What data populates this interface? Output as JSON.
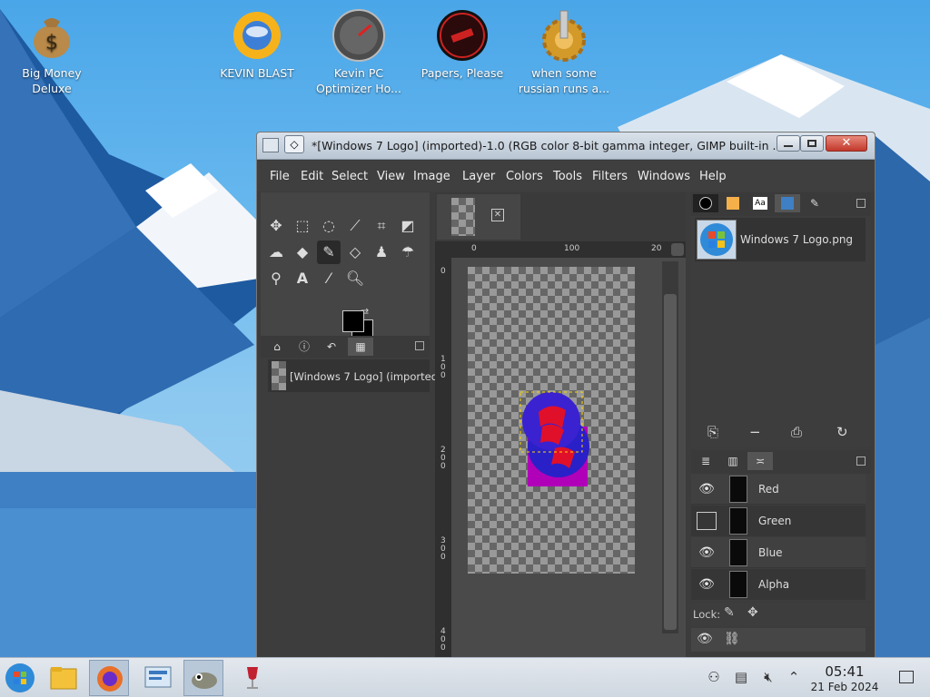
{
  "desktop": {
    "icons": [
      {
        "label": "Big Money Deluxe"
      },
      {
        "label": "KEVIN BLAST"
      },
      {
        "label": "Kevin PC Optimizer Ho..."
      },
      {
        "label": "Papers, Please"
      },
      {
        "label": "when some russian runs a..."
      }
    ]
  },
  "window": {
    "title": "*[Windows 7 Logo] (imported)-1.0 (RGB color 8-bit gamma integer, GIMP built-in ...",
    "menu": [
      "File",
      "Edit",
      "Select",
      "View",
      "Image",
      "Layer",
      "Colors",
      "Tools",
      "Filters",
      "Windows",
      "Help"
    ],
    "images_panel": {
      "item": "[Windows 7 Logo] (imported"
    },
    "ruler": {
      "h": [
        "0",
        "100",
        "20"
      ],
      "v": [
        "0",
        "1 0 0",
        "2 0 0",
        "3 0 0",
        "4 0 0"
      ]
    },
    "brushes_panel": {
      "file": "Windows 7 Logo.png"
    },
    "channels": [
      {
        "name": "Red",
        "visible": true
      },
      {
        "name": "Green",
        "visible": false
      },
      {
        "name": "Blue",
        "visible": true
      },
      {
        "name": "Alpha",
        "visible": true
      }
    ],
    "lock_label": "Lock:"
  },
  "taskbar": {
    "time": "05:41",
    "date": "21 Feb 2024"
  },
  "colors": {
    "accent": "#4aa6e8",
    "panel": "#454545",
    "fg_color": "#000000",
    "bg_color": "#000000"
  }
}
